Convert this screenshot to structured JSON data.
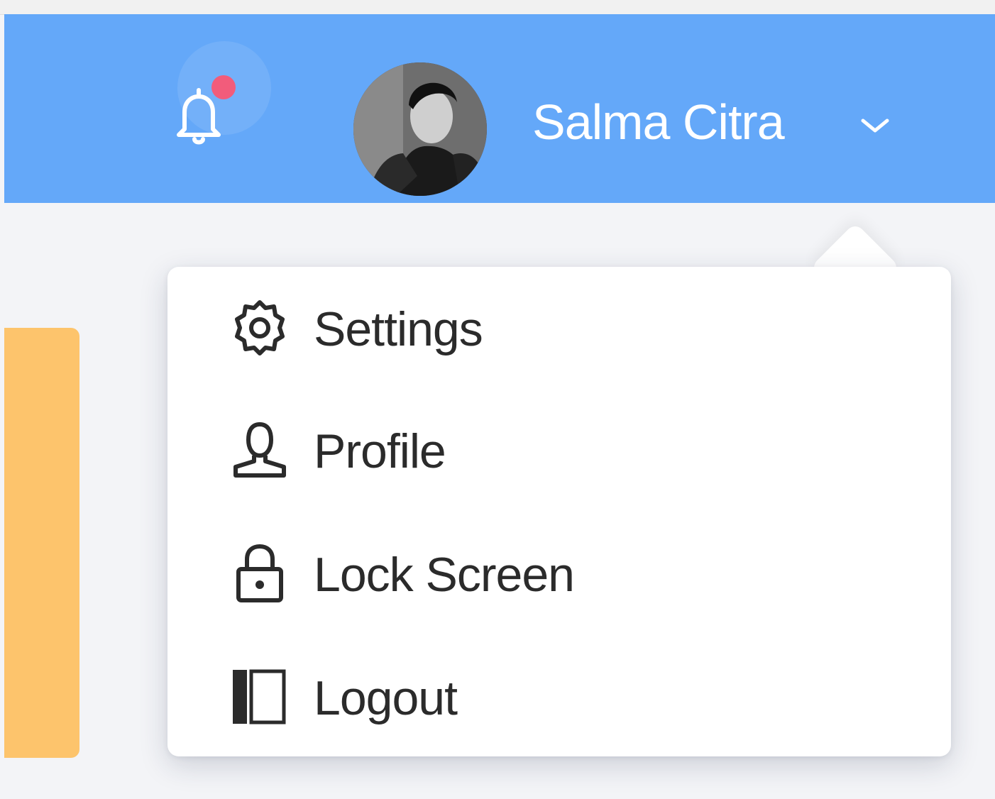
{
  "header": {
    "user_name": "Salma Citra",
    "has_unread_notifications": true
  },
  "menu": {
    "items": [
      {
        "label": "Settings",
        "icon": "gear-icon"
      },
      {
        "label": "Profile",
        "icon": "user-icon"
      },
      {
        "label": "Lock Screen",
        "icon": "lock-icon"
      },
      {
        "label": "Logout",
        "icon": "logout-icon"
      }
    ]
  },
  "colors": {
    "header_blue": "#64a8f9",
    "notification_dot": "#f25c7b",
    "card_yellow": "#fdc46c",
    "menu_text": "#2b2b2b"
  }
}
